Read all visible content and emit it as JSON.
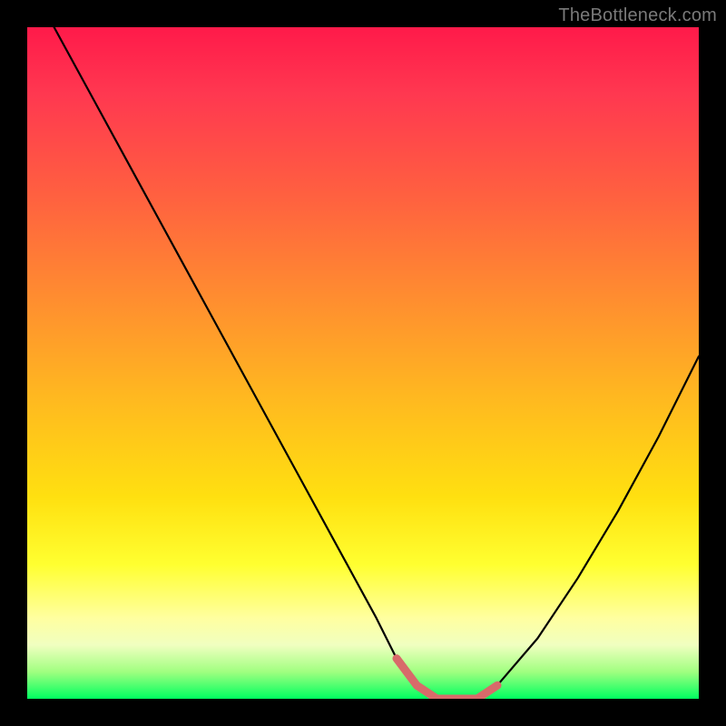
{
  "watermark": "TheBottleneck.com",
  "chart_data": {
    "type": "line",
    "title": "",
    "xlabel": "",
    "ylabel": "",
    "xlim": [
      0,
      100
    ],
    "ylim": [
      0,
      100
    ],
    "grid": false,
    "legend": false,
    "colors": {
      "gradient_top": "#ff1a4a",
      "gradient_bottom": "#00ff60",
      "curve": "#000000",
      "highlight": "#d86a6a"
    },
    "series": [
      {
        "name": "bottleneck-curve",
        "x": [
          4,
          10,
          16,
          22,
          28,
          34,
          40,
          46,
          52,
          55,
          58,
          61,
          64,
          67,
          70,
          76,
          82,
          88,
          94,
          100
        ],
        "y": [
          100,
          89,
          78,
          67,
          56,
          45,
          34,
          23,
          12,
          6,
          2,
          0,
          0,
          0,
          2,
          9,
          18,
          28,
          39,
          51
        ]
      },
      {
        "name": "optimal-segment",
        "x": [
          55,
          58,
          61,
          64,
          67,
          70
        ],
        "y": [
          6,
          2,
          0,
          0,
          0,
          2
        ]
      }
    ]
  }
}
